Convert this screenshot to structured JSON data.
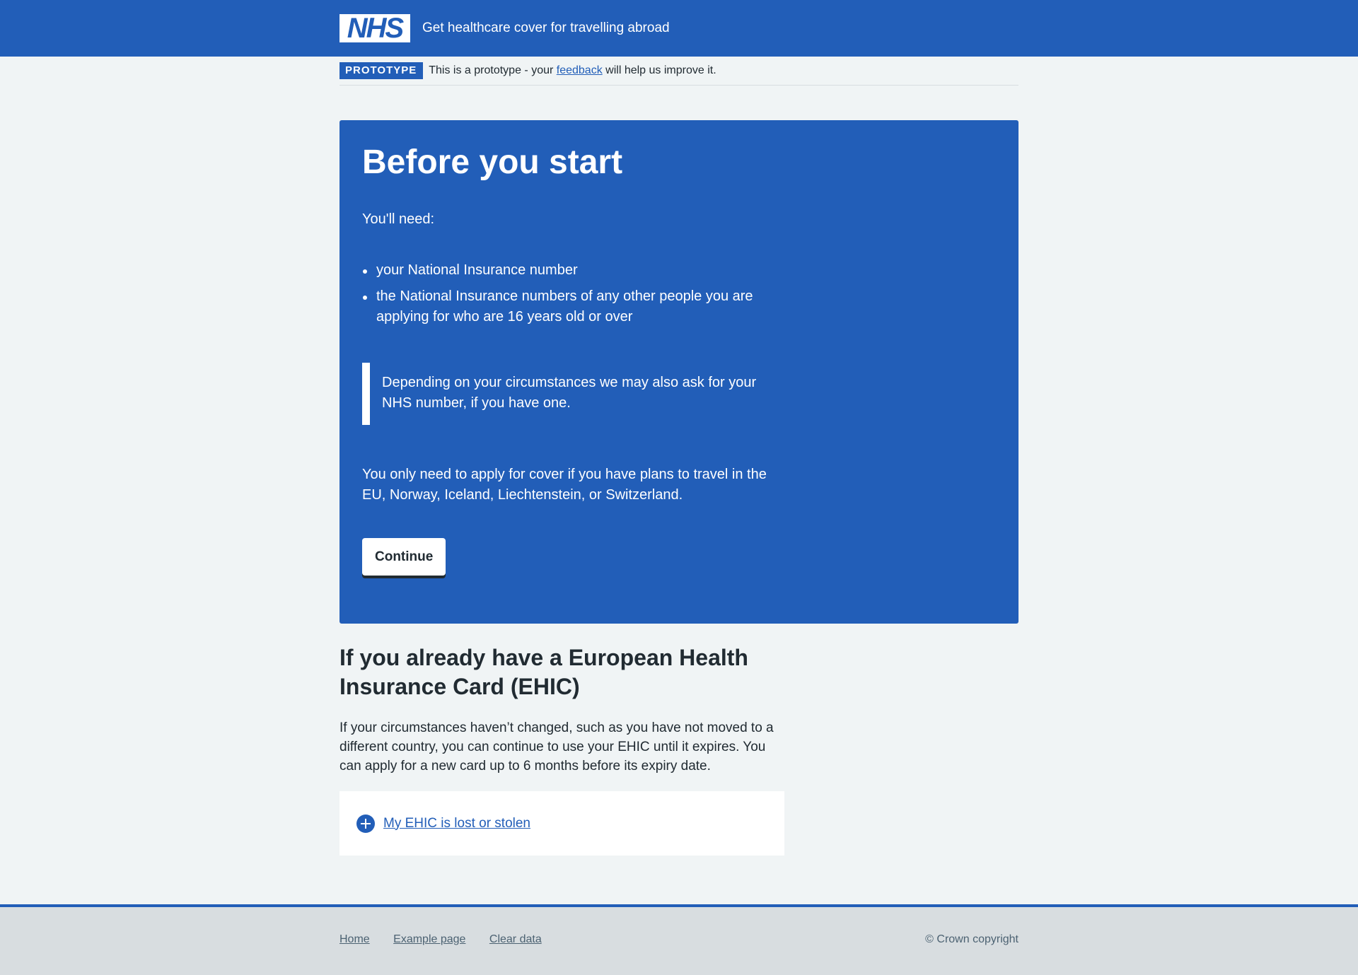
{
  "header": {
    "logo_text": "NHS",
    "service_name": "Get healthcare cover for travelling abroad"
  },
  "phase_banner": {
    "tag": "PROTOTYPE",
    "text_before": "This is a prototype - your ",
    "link": "feedback",
    "text_after": " will help us improve it."
  },
  "hero": {
    "title": "Before you start",
    "need": "You'll need:",
    "items": [
      "your National Insurance number",
      "the National Insurance numbers of any other people you are applying for who are 16 years old or over"
    ],
    "inset": "Depending on your circumstances we may also ask for your NHS number, if you have one.",
    "only": "You only need to apply for cover if you have plans to travel in the EU, Norway, Iceland, Liechtenstein, or Switzerland.",
    "continue_label": "Continue"
  },
  "ehic": {
    "heading": "If you already have a European Health Insurance Card (EHIC)",
    "body": "If your circumstances haven’t changed, such as you have not moved to a different country, you can continue to use your EHIC until it expires. You can apply for a new card up to 6 months before its expiry date.",
    "details_summary": "My EHIC is lost or stolen"
  },
  "footer": {
    "links": [
      "Home",
      "Example page",
      "Clear data"
    ],
    "copyright": "© Crown copyright"
  },
  "colors": {
    "nhs_blue": "#225eb8",
    "page_bg": "#f0f4f5",
    "footer_bg": "#d8dde0",
    "text": "#212b32"
  }
}
